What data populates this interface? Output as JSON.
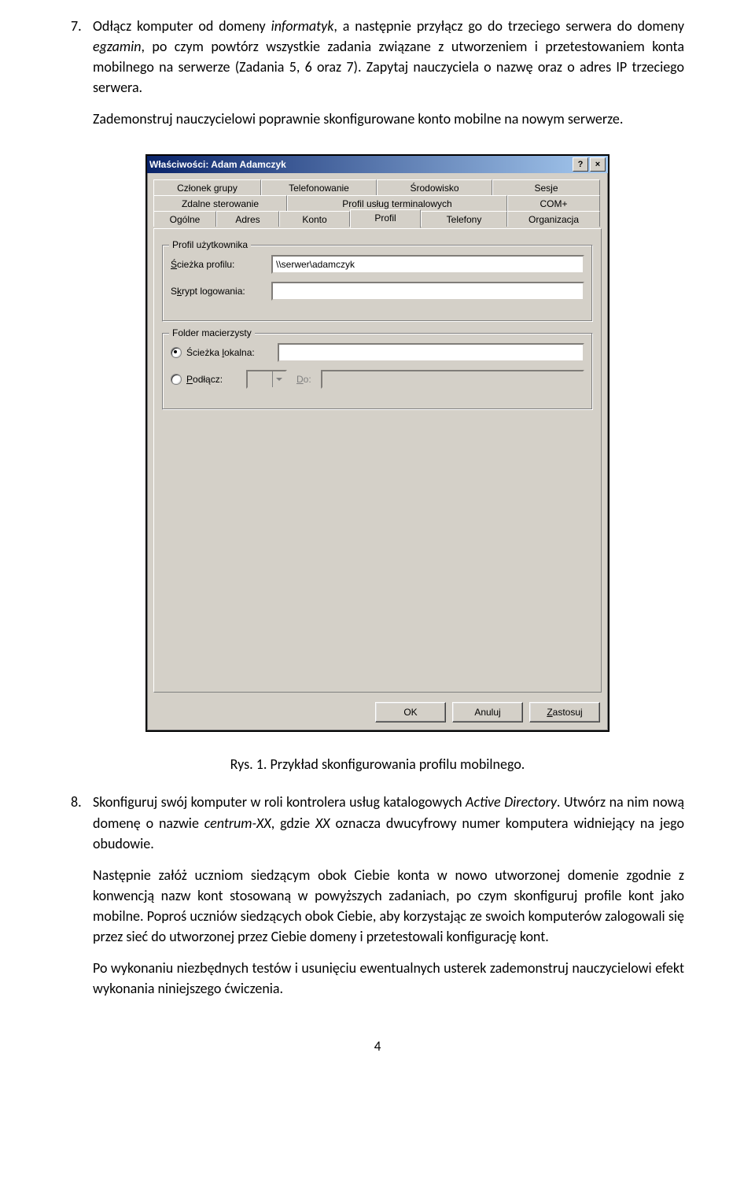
{
  "item7": {
    "num": "7.",
    "text_html": "Odłącz komputer od domeny <em>informatyk</em>, a następnie przyłącz go do trzeciego serwera do domeny <em>egzamin</em>, po czym powtórz wszystkie zadania związane z utworzeniem i przetestowaniem konta mobilnego na serwerze (Zadania 5, 6 oraz 7). Zapytaj nauczyciela o nazwę oraz o adres IP trzeciego serwera.",
    "para2": "Zademonstruj nauczycielowi poprawnie skonfigurowane konto mobilne na nowym serwerze."
  },
  "dialog": {
    "title": "Właściwości: Adam Adamczyk",
    "help": "?",
    "close": "×",
    "tabs": {
      "czlonek": "Członek grupy",
      "telefon": "Telefonowanie",
      "srod": "Środowisko",
      "sesje": "Sesje",
      "zdalne": "Zdalne sterowanie",
      "profusl": "Profil usług terminalowych",
      "com": "COM+",
      "ogolne": "Ogólne",
      "adres": "Adres",
      "konto": "Konto",
      "profil": "Profil",
      "telefony": "Telefony",
      "org": "Organizacja"
    },
    "group1": {
      "title": "Profil użytkownika",
      "path_label_html": "<span class='under'>Ś</span>cieżka profilu:",
      "path_value": "\\\\serwer\\adamczyk",
      "script_label_html": "S<span class='under'>k</span>rypt logowania:"
    },
    "group2": {
      "title": "Folder macierzysty",
      "local_label_html": "Ścieżka <span class='under'>l</span>okalna:",
      "connect_label_html": "<span class='under'>P</span>odłącz:",
      "do_label_html": "<span class='under'>D</span>o:"
    },
    "buttons": {
      "ok": "OK",
      "cancel": "Anuluj",
      "apply_html": "<span class='under'>Z</span>astosuj"
    }
  },
  "caption": "Rys. 1. Przykład skonfigurowania profilu mobilnego.",
  "item8": {
    "num": "8.",
    "text_html": "Skonfiguruj swój komputer w roli kontrolera usług katalogowych <em>Active Directory</em>. Utwórz na nim nową domenę o nazwie <em>centrum-XX</em>, gdzie <em>XX</em> oznacza dwucyfrowy numer komputera widniejący na jego obudowie.",
    "para2": "Następnie załóż uczniom siedzącym obok Ciebie konta w nowo utworzonej domenie zgodnie z konwencją nazw kont stosowaną w powyższych zadaniach, po czym skonfiguruj profile kont jako mobilne. Poproś uczniów siedzących obok Ciebie, aby korzystając ze swoich komputerów zalogowali się przez sieć do utworzonej przez Ciebie domeny i przetestowali konfigurację kont.",
    "para3": "Po wykonaniu niezbędnych testów i usunięciu ewentualnych usterek zademonstruj nauczycielowi efekt wykonania niniejszego ćwiczenia."
  },
  "page_num": "4"
}
